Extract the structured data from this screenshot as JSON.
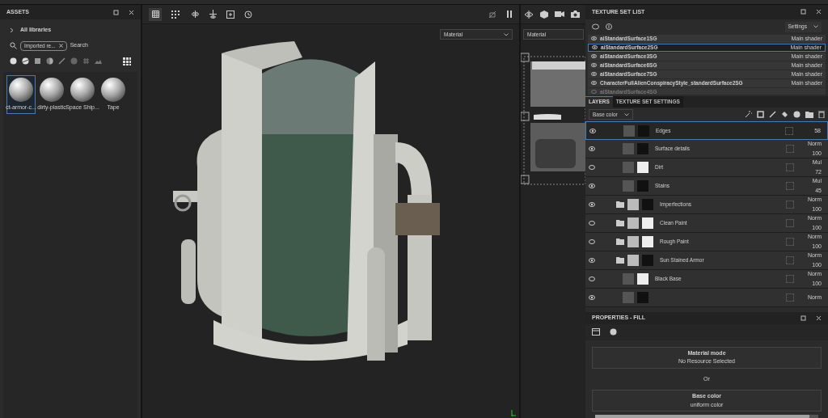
{
  "assets": {
    "title": "ASSETS",
    "library": "All libraries",
    "search": {
      "value": "Imported re...",
      "label": "Search"
    },
    "items": [
      {
        "label": "ct-armor-c...",
        "selected": true
      },
      {
        "label": "dirty-plastic",
        "selected": false
      },
      {
        "label": "Space Ship...",
        "selected": false
      },
      {
        "label": "Tape",
        "selected": false
      }
    ]
  },
  "viewport": {
    "dropdowns": [
      {
        "value": "Material"
      },
      {
        "value": "Material"
      }
    ]
  },
  "texture_set_list": {
    "title": "TEXTURE SET LIST",
    "settings": "Settings",
    "items": [
      {
        "name": "aiStandardSurface1SG",
        "shader": "Main shader",
        "selected": false,
        "disabled": false
      },
      {
        "name": "aiStandardSurface2SG",
        "shader": "Main shader",
        "selected": true,
        "disabled": false
      },
      {
        "name": "aiStandardSurface3SG",
        "shader": "Main shader",
        "selected": false,
        "disabled": false
      },
      {
        "name": "aiStandardSurface6SG",
        "shader": "Main shader",
        "selected": false,
        "disabled": false
      },
      {
        "name": "aiStandardSurface7SG",
        "shader": "Main shader",
        "selected": false,
        "disabled": false
      },
      {
        "name": "CharacterFullAlienConspiracyStyle_standardSurface2SG",
        "shader": "Main shader",
        "selected": false,
        "disabled": false
      },
      {
        "name": "aiStandardSurface4SG",
        "selected": false,
        "disabled": true
      }
    ]
  },
  "layers": {
    "tabs": [
      {
        "label": "LAYERS",
        "selected": true
      },
      {
        "label": "TEXTURE SET SETTINGS",
        "selected": false
      }
    ],
    "channel": "Base color",
    "items": [
      {
        "kind": "fill",
        "name": "Edges",
        "opacity": "58",
        "visible": true,
        "selected": true
      },
      {
        "kind": "fill",
        "name": "Surface details",
        "blend": "Norm",
        "opacity": "100",
        "visible": true,
        "selected": false
      },
      {
        "kind": "fill",
        "name": "Dirt",
        "blend": "Mul",
        "opacity": "72",
        "visible": false,
        "selected": false
      },
      {
        "kind": "fill",
        "name": "Stains",
        "blend": "Mul",
        "opacity": "45",
        "visible": true,
        "selected": false
      },
      {
        "kind": "folder",
        "name": "Imperfections",
        "blend": "Norm",
        "opacity": "100",
        "visible": true,
        "selected": false
      },
      {
        "kind": "folder",
        "name": "Clean Paint",
        "blend": "Norm",
        "opacity": "100",
        "visible": false,
        "selected": false
      },
      {
        "kind": "folder",
        "name": "Rough Paint",
        "blend": "Norm",
        "opacity": "100",
        "visible": false,
        "selected": false
      },
      {
        "kind": "folder",
        "name": "Sun Stained Armor",
        "blend": "Norm",
        "opacity": "100",
        "visible": true,
        "selected": false
      },
      {
        "kind": "fill",
        "name": "Black Base",
        "blend": "Norm",
        "opacity": "100",
        "visible": false,
        "selected": false
      },
      {
        "kind": "fill",
        "blend": "Norm",
        "visible": true,
        "selected": false
      }
    ]
  },
  "properties": {
    "title": "PROPERTIES - FILL",
    "material_mode": {
      "title": "Material mode",
      "value": "No Resource Selected"
    },
    "separator": "Or",
    "base_color": {
      "title": "Base color",
      "value": "uniform color",
      "level": 0.96
    }
  }
}
